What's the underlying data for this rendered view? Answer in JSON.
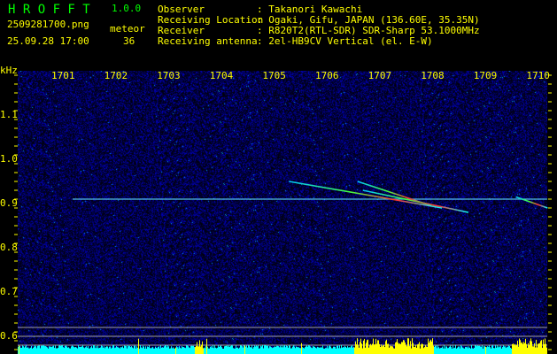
{
  "header": {
    "app_title": "H R O F F T",
    "version": "1.0.0",
    "filename": "2509281700.png",
    "datetime": "25.09.28 17:00",
    "meteor_label": "meteor",
    "meteor_count": "36",
    "info": [
      {
        "label": "Observer",
        "value": ": Takanori Kawachi"
      },
      {
        "label": "Receiving Location",
        "value": ": Ogaki, Gifu, JAPAN (136.60E, 35.35N)"
      },
      {
        "label": "Receiver",
        "value": ": R820T2(RTL-SDR) SDR-Sharp 53.1000MHz"
      },
      {
        "label": "Receiving antenna",
        "value": ": 2el-HB9CV Vertical (el. E-W)"
      }
    ]
  },
  "colors": {
    "text": "#ffff00",
    "title": "#00ff00",
    "background": "#000000",
    "noise": "#0a1aa0",
    "level_normal": "#00ffff",
    "level_high": "#ffff00"
  },
  "chart_data": {
    "type": "heatmap",
    "ylabel": "kHz",
    "x_ticks": [
      "1701",
      "1702",
      "1703",
      "1704",
      "1705",
      "1706",
      "1707",
      "1708",
      "1709",
      "1710"
    ],
    "y_ticks": [
      "1.1",
      "1.0",
      "0.9",
      "0.8",
      "0.7",
      "0.6"
    ],
    "ylim": [
      0.56,
      1.2
    ],
    "carrier_khz": 0.91,
    "meteor_echoes": [
      {
        "start_time": "1705.3",
        "end_time": "1708.2",
        "start_khz": 0.95,
        "end_khz": 0.89
      },
      {
        "start_time": "1706.6",
        "end_time": "1708.0",
        "start_khz": 0.95,
        "end_khz": 0.895
      },
      {
        "start_time": "1706.7",
        "end_time": "1708.7",
        "start_khz": 0.93,
        "end_khz": 0.88
      },
      {
        "start_time": "1709.6",
        "end_time": "1710.2",
        "start_khz": 0.915,
        "end_khz": 0.89
      }
    ]
  }
}
